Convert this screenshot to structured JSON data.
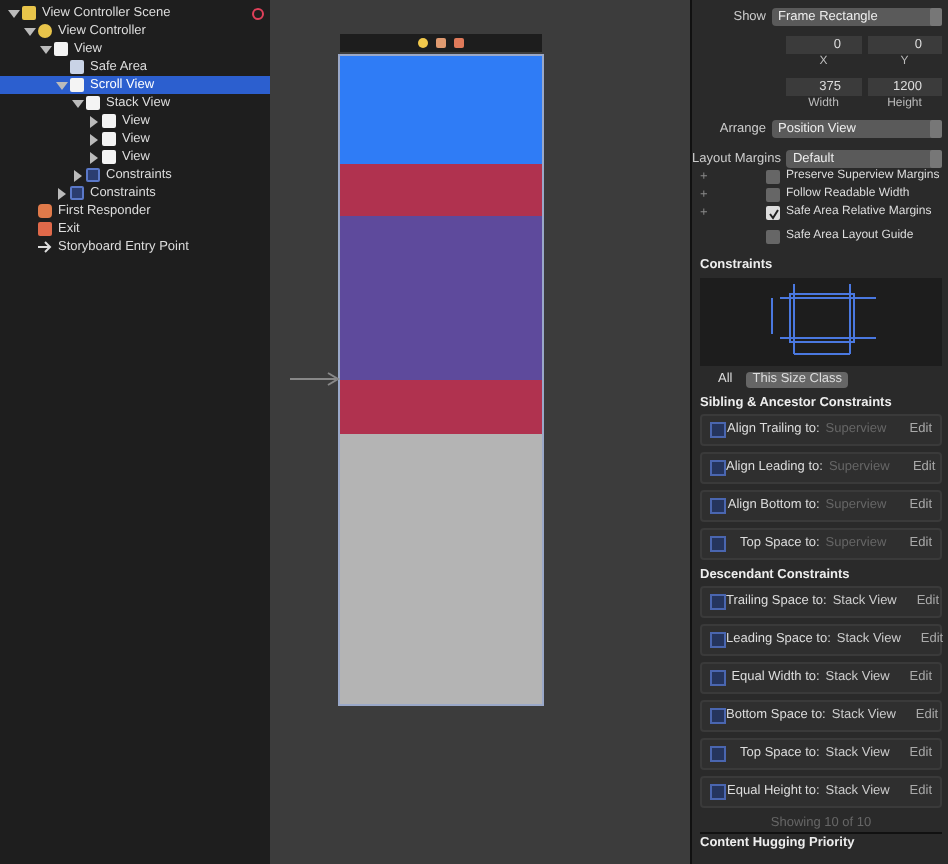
{
  "outline": [
    {
      "label": "View Controller Scene",
      "kind": "scene",
      "expanded": true,
      "selected": false,
      "children": [
        {
          "label": "View Controller",
          "kind": "controller",
          "expanded": true,
          "selected": false,
          "children": [
            {
              "label": "View",
              "kind": "view",
              "expanded": true,
              "selected": false,
              "children": [
                {
                  "label": "Safe Area",
                  "kind": "safearea",
                  "selected": false
                },
                {
                  "label": "Scroll View",
                  "kind": "view",
                  "expanded": true,
                  "selected": true,
                  "children": [
                    {
                      "label": "Stack View",
                      "kind": "stack",
                      "expanded": true,
                      "selected": false,
                      "children": [
                        {
                          "label": "View",
                          "kind": "view",
                          "expanded": false,
                          "selected": false
                        },
                        {
                          "label": "View",
                          "kind": "view",
                          "expanded": false,
                          "selected": false
                        },
                        {
                          "label": "View",
                          "kind": "view",
                          "expanded": false,
                          "selected": false
                        }
                      ]
                    },
                    {
                      "label": "Constraints",
                      "kind": "constraints",
                      "expanded": false,
                      "selected": false
                    }
                  ]
                },
                {
                  "label": "Constraints",
                  "kind": "constraints",
                  "expanded": false,
                  "selected": false
                }
              ]
            }
          ]
        },
        {
          "label": "First Responder",
          "kind": "responder",
          "selected": false
        },
        {
          "label": "Exit",
          "kind": "exit",
          "selected": false
        },
        {
          "label": "Storyboard Entry Point",
          "kind": "entry",
          "selected": false
        }
      ]
    }
  ],
  "canvas": {
    "blocks": [
      {
        "color": "#2f7cf6"
      },
      {
        "color": "#b0324f"
      },
      {
        "color": "#5e4a9c"
      },
      {
        "color": "#b0324f"
      },
      {
        "color": "#b4b4b4"
      }
    ]
  },
  "inspector": {
    "show": {
      "label": "Show",
      "value": "Frame Rectangle"
    },
    "frame": [
      {
        "value": "0",
        "caption": "X"
      },
      {
        "value": "0",
        "caption": "Y"
      },
      {
        "value": "375",
        "caption": "Width"
      },
      {
        "value": "1200",
        "caption": "Height"
      }
    ],
    "arrange": {
      "label": "Arrange",
      "value": "Position View"
    },
    "layout_margins": {
      "label": "Layout Margins",
      "value": "Default"
    },
    "checkboxes": [
      {
        "label": "Preserve Superview Margins",
        "checked": false,
        "plus": "+"
      },
      {
        "label": "Follow Readable Width",
        "checked": false,
        "plus": "+"
      },
      {
        "label": "Safe Area Relative Margins",
        "checked": true,
        "plus": "+"
      },
      {
        "label": "Safe Area Layout Guide",
        "checked": false
      }
    ],
    "constraints_title": "Constraints",
    "filter_tabs": [
      {
        "label": "All",
        "selected": false
      },
      {
        "label": "This Size Class",
        "selected": true
      }
    ],
    "groups": [
      {
        "title": "Sibling & Ancestor Constraints",
        "rows": [
          {
            "label": "Align Trailing to:",
            "target": "Superview",
            "dimmed": true,
            "action": "Edit"
          },
          {
            "label": "Align Leading to:",
            "target": "Superview",
            "dimmed": true,
            "action": "Edit"
          },
          {
            "label": "Align Bottom to:",
            "target": "Superview",
            "dimmed": true,
            "action": "Edit"
          },
          {
            "label": "Top Space to:",
            "target": "Superview",
            "dimmed": true,
            "action": "Edit"
          }
        ]
      },
      {
        "title": "Descendant Constraints",
        "rows": [
          {
            "label": "Trailing Space to:",
            "target": "Stack View",
            "dimmed": false,
            "action": "Edit"
          },
          {
            "label": "Leading Space to:",
            "target": "Stack View",
            "dimmed": false,
            "action": "Edit"
          },
          {
            "label": "Equal Width to:",
            "target": "Stack View",
            "dimmed": false,
            "action": "Edit"
          },
          {
            "label": "Bottom Space to:",
            "target": "Stack View",
            "dimmed": false,
            "action": "Edit"
          },
          {
            "label": "Top Space to:",
            "target": "Stack View",
            "dimmed": false,
            "action": "Edit"
          },
          {
            "label": "Equal Height to:",
            "target": "Stack View",
            "dimmed": false,
            "action": "Edit"
          }
        ]
      }
    ],
    "showing": "Showing 10 of 10",
    "hugging_title": "Content Hugging Priority"
  }
}
